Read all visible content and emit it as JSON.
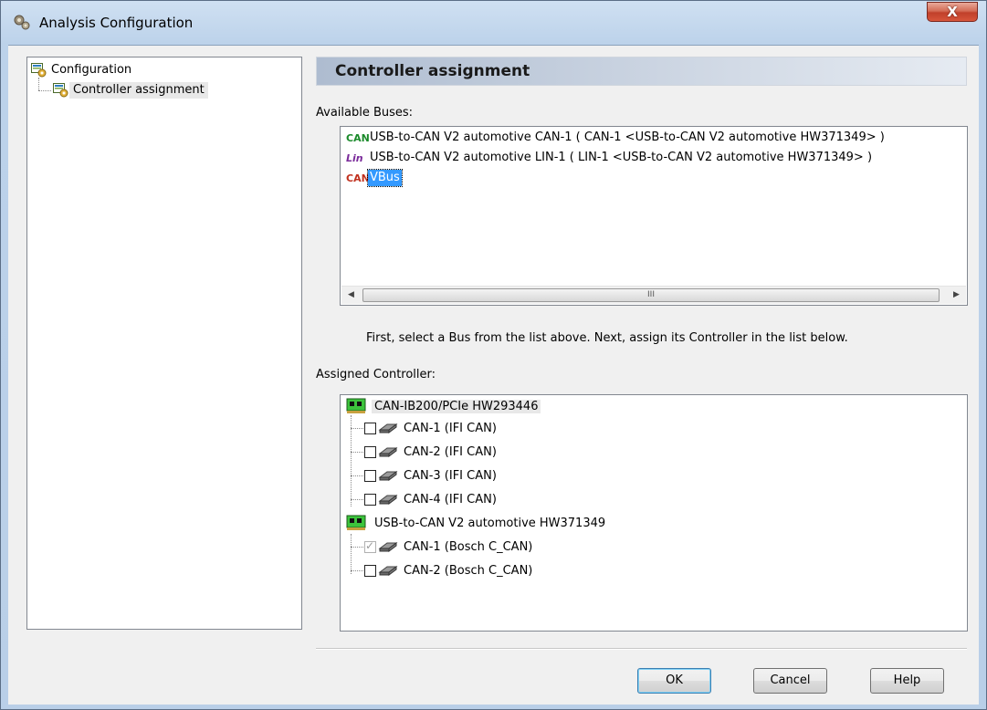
{
  "window": {
    "title": "Analysis Configuration",
    "close_glyph": "X",
    "accent_color": "#3399ff"
  },
  "tree": {
    "items": [
      {
        "label": "Configuration",
        "icon": "configuration-icon"
      },
      {
        "label": "Controller assignment",
        "icon": "configuration-icon",
        "selected": true
      }
    ]
  },
  "panel": {
    "header": "Controller assignment",
    "available_buses_label": "Available Buses:",
    "buses": [
      {
        "icon_text": "CAN",
        "icon": "can-bus-icon",
        "label": "USB-to-CAN V2 automotive  CAN-1  ( CAN-1  <USB-to-CAN V2 automotive  HW371349> )"
      },
      {
        "icon_text": "Lin",
        "icon": "lin-bus-icon",
        "label": "USB-to-CAN V2 automotive  LIN-1  ( LIN-1  <USB-to-CAN V2 automotive  HW371349> )"
      },
      {
        "icon_text": "CAN",
        "icon": "vbus-icon",
        "label": "VBus",
        "selected": true
      }
    ],
    "scroll_thumb_glyph": "III",
    "instruction": "First, select a Bus from the list above.  Next, assign its Controller in the list below.",
    "assigned_controller_label": "Assigned Controller:",
    "controllers": [
      {
        "board": "CAN-IB200/PCIe  HW293446",
        "channels": [
          {
            "label": "CAN-1  (IFI CAN)",
            "checked": false,
            "disabled": false
          },
          {
            "label": "CAN-2  (IFI CAN)",
            "checked": false,
            "disabled": false
          },
          {
            "label": "CAN-3  (IFI CAN)",
            "checked": false,
            "disabled": false
          },
          {
            "label": "CAN-4  (IFI CAN)",
            "checked": false,
            "disabled": false
          }
        ]
      },
      {
        "board": "USB-to-CAN V2 automotive  HW371349",
        "channels": [
          {
            "label": "CAN-1  (Bosch C_CAN)",
            "checked": true,
            "disabled": true
          },
          {
            "label": "CAN-2  (Bosch C_CAN)",
            "checked": false,
            "disabled": false
          }
        ]
      }
    ]
  },
  "buttons": {
    "ok": "OK",
    "cancel": "Cancel",
    "help": "Help"
  }
}
